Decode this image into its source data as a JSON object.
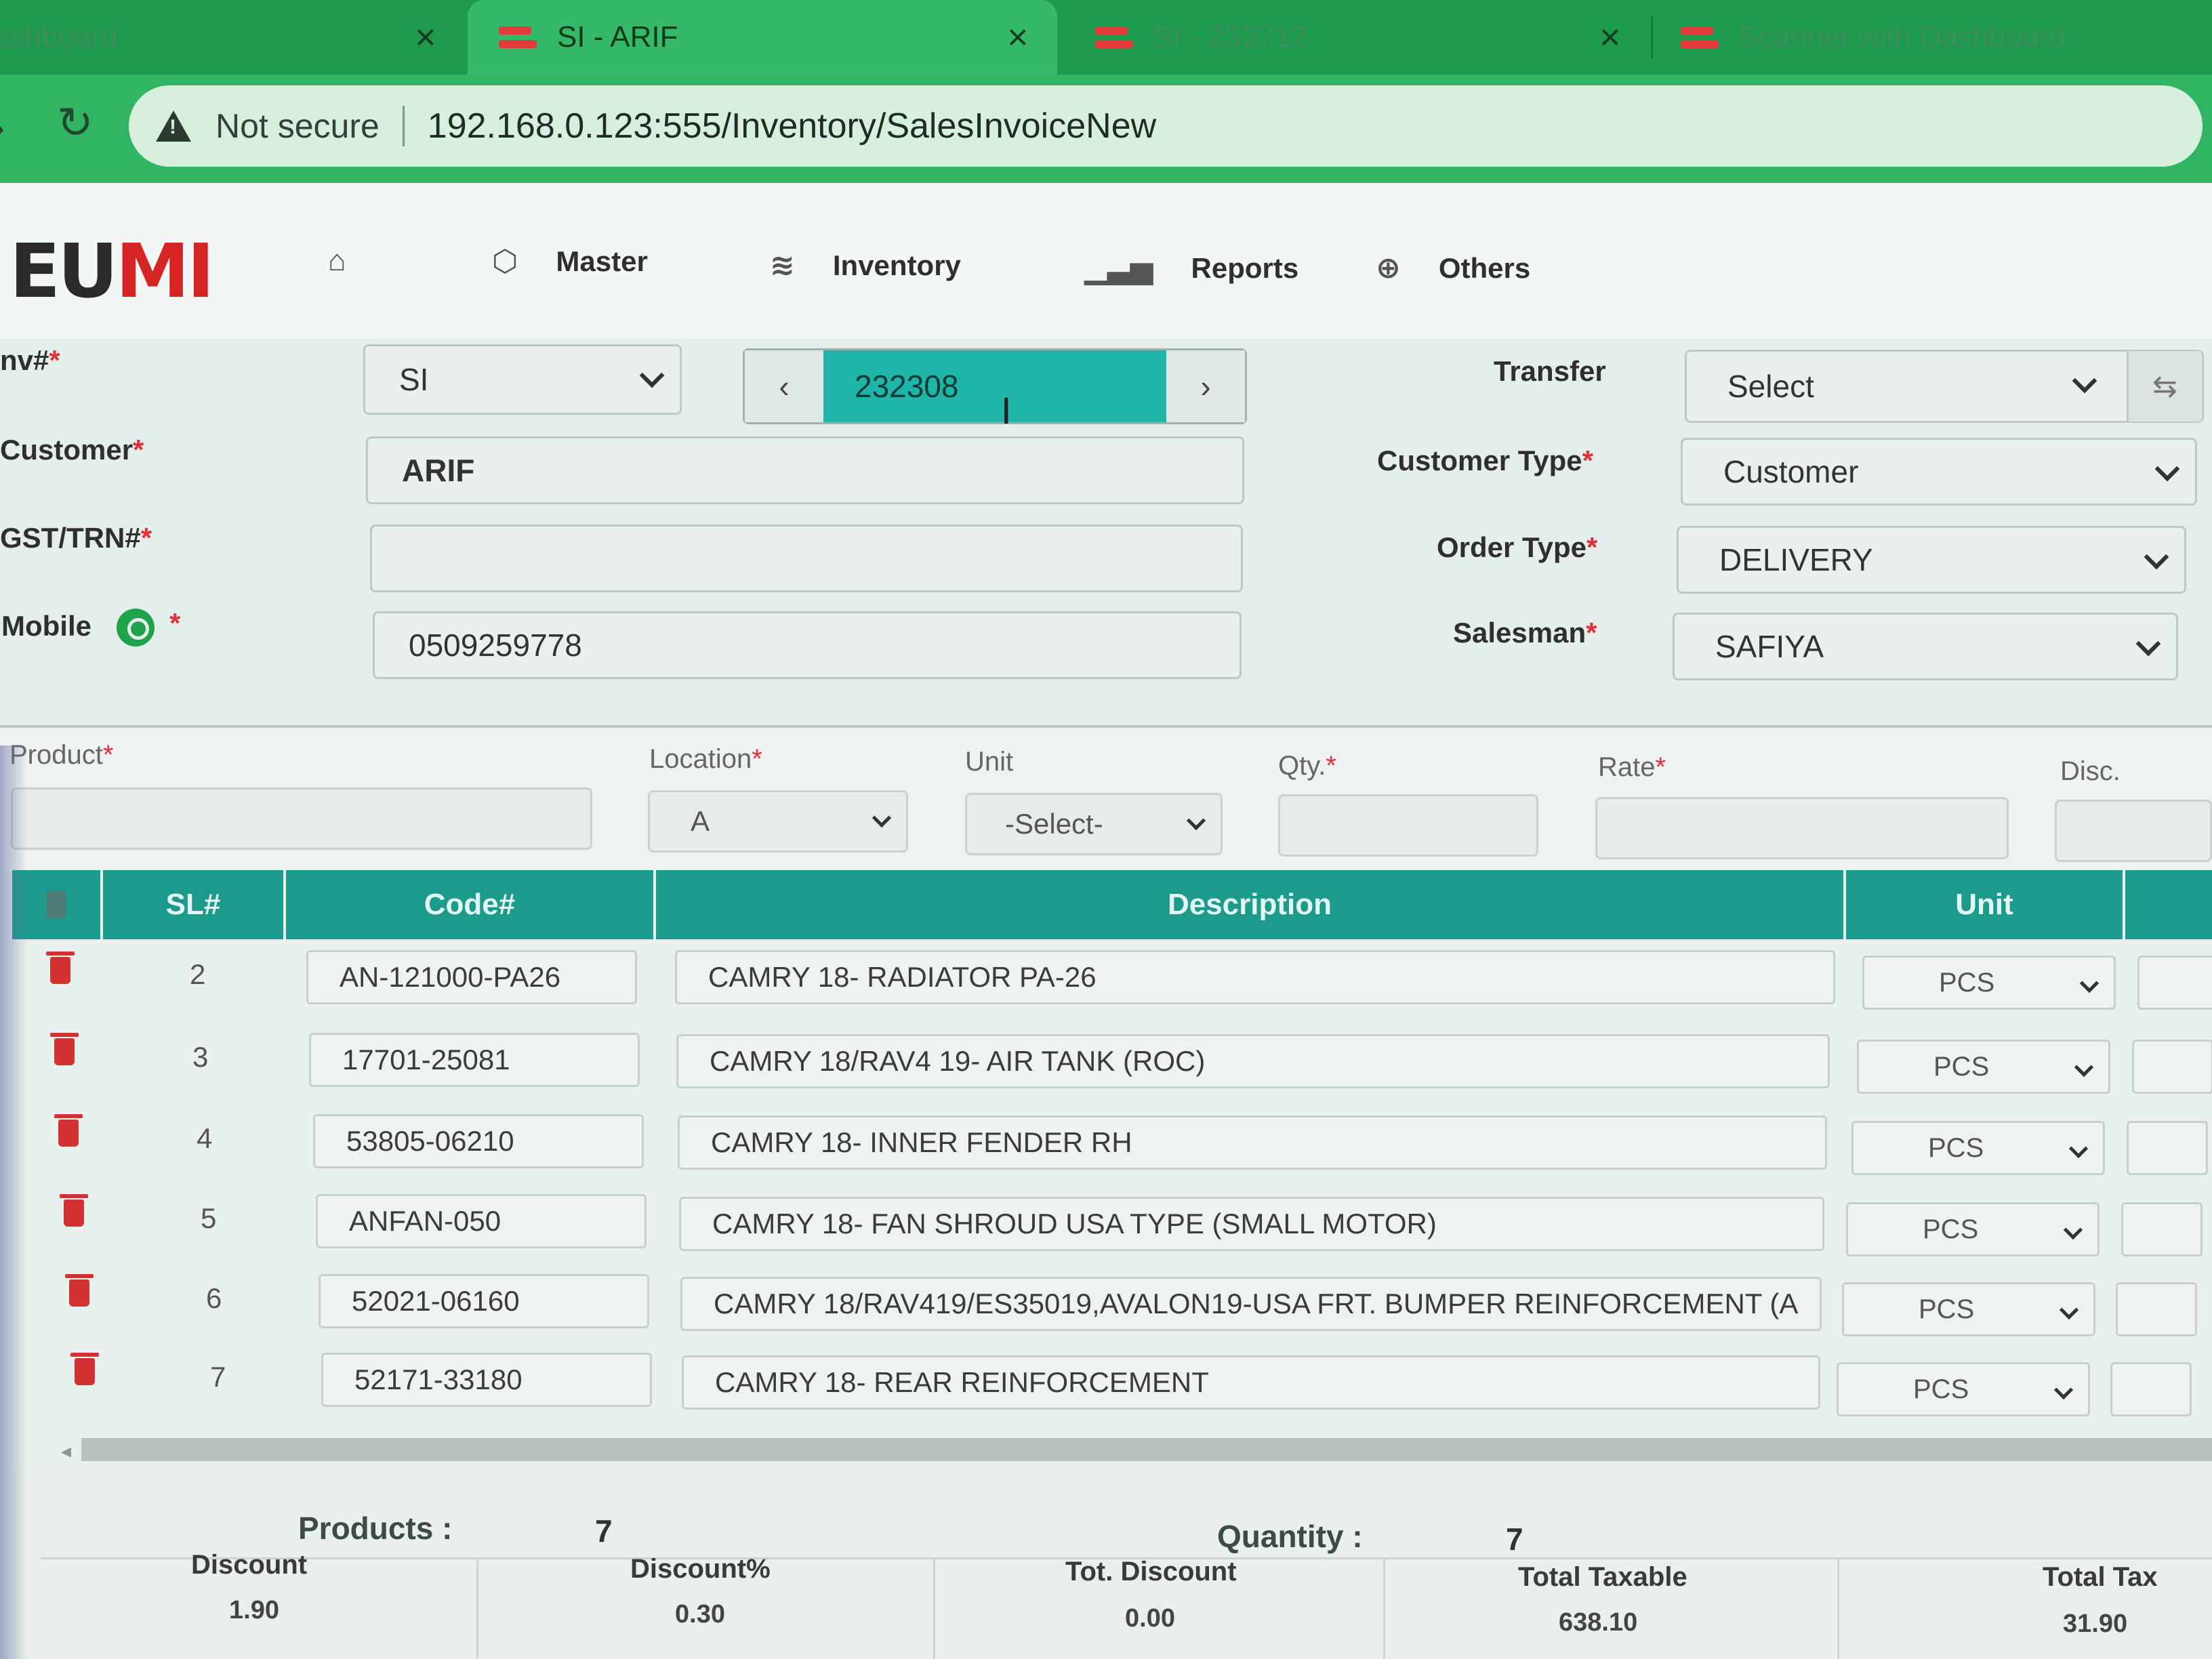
{
  "browser": {
    "tabs": [
      {
        "title": "ashboard",
        "state": "inactive"
      },
      {
        "title": "SI - ARIF",
        "state": "active"
      },
      {
        "title": "SI - 233712",
        "state": "inactive"
      },
      {
        "title": "Scanner with Dashboard",
        "state": "inactive"
      }
    ],
    "security_label": "Not secure",
    "url": "192.168.0.123:555/Inventory/SalesInvoiceNew"
  },
  "app": {
    "logo_dark": "EU",
    "logo_red": "MI",
    "menu": [
      {
        "label": "",
        "icon": "home-icon"
      },
      {
        "label": "Master",
        "icon": "cube-icon"
      },
      {
        "label": "Inventory",
        "icon": "layers-icon"
      },
      {
        "label": "Reports",
        "icon": "bar-chart-icon"
      },
      {
        "label": "Others",
        "icon": "globe-icon"
      }
    ]
  },
  "form": {
    "inv_label": "nv#",
    "inv_prefix": "SI",
    "inv_number": "232308",
    "customer_label": "Customer",
    "customer_value": "ARIF",
    "gst_label": "GST/TRN#",
    "gst_value": "",
    "mobile_label": "Mobile",
    "mobile_value": "0509259778",
    "transfer_label": "Transfer",
    "transfer_value": "Select",
    "customer_type_label": "Customer Type",
    "customer_type_value": "Customer",
    "order_type_label": "Order Type",
    "order_type_value": "DELIVERY",
    "salesman_label": "Salesman",
    "salesman_value": "SAFIYA",
    "required_mark": "*"
  },
  "entry": {
    "product_label": "Product",
    "location_label": "Location",
    "location_value": "A",
    "unit_label": "Unit",
    "unit_value": "-Select-",
    "qty_label": "Qty.",
    "rate_label": "Rate",
    "disc_label": "Disc."
  },
  "table": {
    "headers": {
      "sl": "SL#",
      "code": "Code#",
      "description": "Description",
      "unit": "Unit"
    },
    "rows": [
      {
        "sl": "2",
        "code": "AN-121000-PA26",
        "description": "CAMRY 18- RADIATOR PA-26",
        "unit": "PCS"
      },
      {
        "sl": "3",
        "code": "17701-25081",
        "description": "CAMRY 18/RAV4 19- AIR TANK (ROC)",
        "unit": "PCS"
      },
      {
        "sl": "4",
        "code": "53805-06210",
        "description": "CAMRY 18- INNER FENDER RH",
        "unit": "PCS"
      },
      {
        "sl": "5",
        "code": "ANFAN-050",
        "description": "CAMRY 18- FAN SHROUD USA TYPE (SMALL MOTOR)",
        "unit": "PCS"
      },
      {
        "sl": "6",
        "code": "52021-06160",
        "description": "CAMRY 18/RAV419/ES35019,AVALON19-USA FRT. BUMPER REINFORCEMENT (A",
        "unit": "PCS"
      },
      {
        "sl": "7",
        "code": "52171-33180",
        "description": "CAMRY 18- REAR REINFORCEMENT",
        "unit": "PCS"
      }
    ]
  },
  "summary": {
    "products_label": "Products :",
    "products_value": "7",
    "quantity_label": "Quantity :",
    "quantity_value": "7",
    "totals": [
      {
        "label": "Discount",
        "value": "1.90"
      },
      {
        "label": "Discount%",
        "value": "0.30"
      },
      {
        "label": "Tot. Discount",
        "value": "0.00"
      },
      {
        "label": "Total Taxable",
        "value": "638.10"
      },
      {
        "label": "Total Tax",
        "value": "31.90"
      }
    ]
  }
}
